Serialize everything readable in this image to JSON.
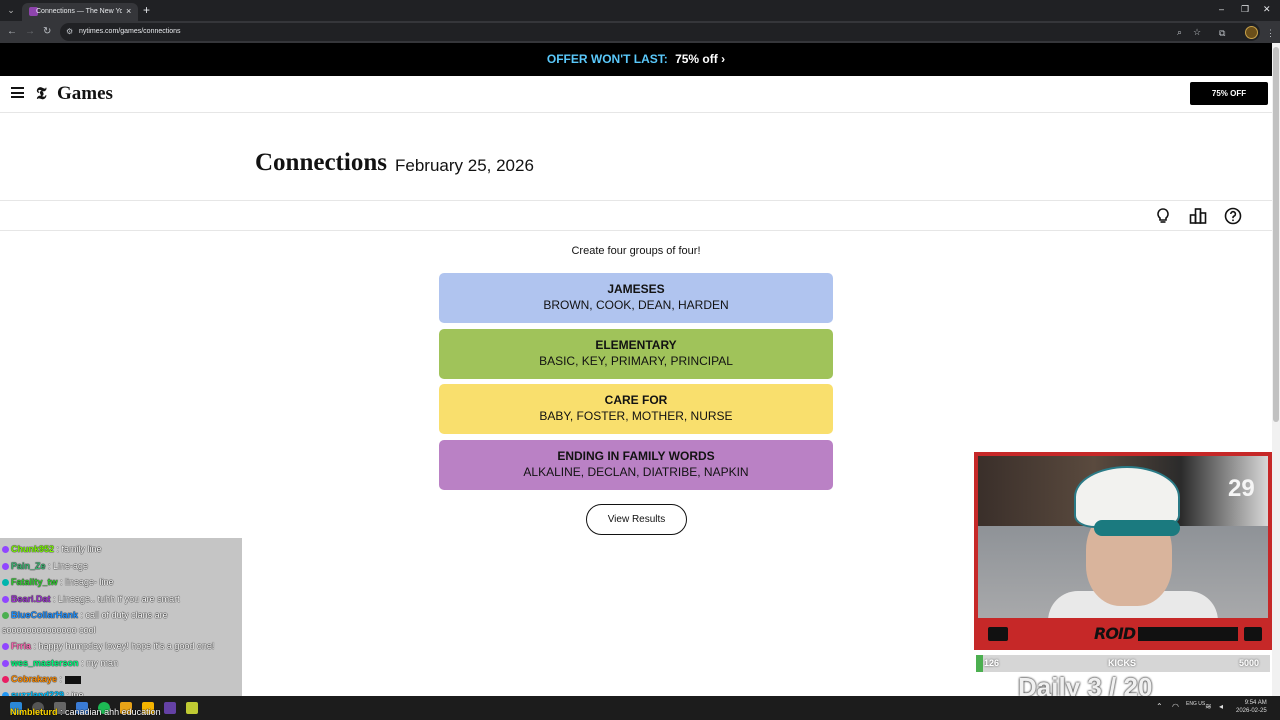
{
  "browser": {
    "tab_title": "Connections — The New York T",
    "url": "nytimes.com/games/connections"
  },
  "promo": {
    "offer_label": "OFFER WON'T LAST:",
    "deal_label": "75% off ›"
  },
  "header": {
    "logo_mark": "𝕿",
    "brand": "Games",
    "cta_label": "75% OFF"
  },
  "game": {
    "title": "Connections",
    "date": "February 25, 2026",
    "instructions": "Create four groups of four!",
    "view_results_label": "View Results",
    "groups": [
      {
        "name": "JAMESES",
        "words": "BROWN, COOK, DEAN, HARDEN",
        "color": "#b0c4ef"
      },
      {
        "name": "ELEMENTARY",
        "words": "BASIC, KEY, PRIMARY, PRINCIPAL",
        "color": "#a0c35a"
      },
      {
        "name": "CARE FOR",
        "words": "BABY, FOSTER, MOTHER, NURSE",
        "color": "#f9df6d"
      },
      {
        "name": "ENDING IN FAMILY WORDS",
        "words": "ALKALINE, DECLAN, DIATRIBE, NAPKIN",
        "color": "#ba81c5"
      }
    ],
    "tool_icons": [
      "lightbulb-icon",
      "leaderboard-icon",
      "help-icon"
    ]
  },
  "chat": {
    "messages": [
      {
        "user": "Chunk952",
        "text": ": family line",
        "color": "#7cfc00"
      },
      {
        "user": "Pain_Ze",
        "text": ": Line-age",
        "color": "#3cb371"
      },
      {
        "user": "Fatality_tw",
        "text": ": lineage- line",
        "color": "#32cd32"
      },
      {
        "user": "Beari.Dat",
        "text": ": Lineage.. tuhh if you are smart",
        "color": "#9932cc"
      },
      {
        "user": "BlueCollarHank",
        "text": ": call of duty clans are",
        "color": "#1e90ff"
      },
      {
        "user": "",
        "text": "soooooooooooooo cool",
        "color": "#ffffff"
      },
      {
        "user": "Frria",
        "text": ": happy humpday lovey! hope it's a good one!",
        "color": "#ff69b4"
      },
      {
        "user": "wes_masterson",
        "text": ": my man",
        "color": "#00ff7f"
      },
      {
        "user": "Cobrakaye",
        "text": ":",
        "color": "#ff8c00"
      },
      {
        "user": "suzzland229",
        "text": ": ine",
        "color": "#00bfff"
      },
      {
        "user": "Nimbleturd",
        "text": ": canadian ahh education",
        "color": "#ffd700"
      }
    ]
  },
  "stream": {
    "jersey_number": "29",
    "brand": "ROID",
    "kicks_current": "126",
    "kicks_label": "KICKS",
    "kicks_goal": "5000",
    "kicks_progress": 0.0252,
    "daily_counter": "Daily 3 / 20"
  },
  "taskbar": {
    "clock_time": "9:54 AM",
    "clock_date": "2026-02-25",
    "lang": "ENG US"
  }
}
